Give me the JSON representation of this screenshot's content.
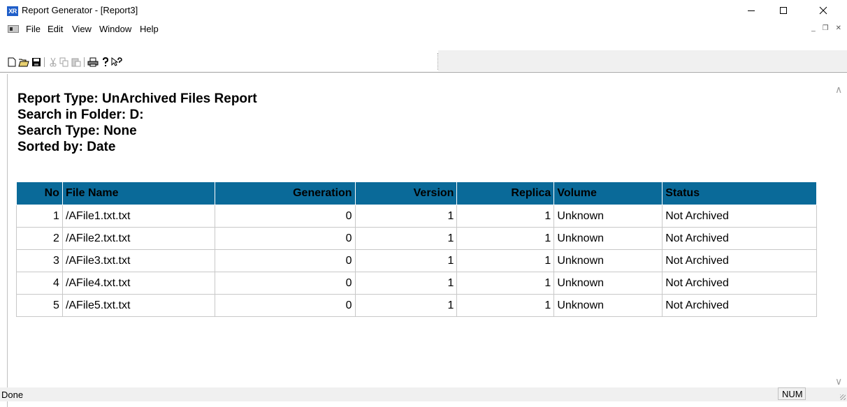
{
  "window": {
    "title": "Report Generator - [Report3]",
    "app_icon_label": "XR",
    "controls": {
      "minimize": "minimize-icon",
      "maximize": "maximize-icon",
      "close": "close-icon"
    }
  },
  "menu": {
    "items": [
      "File",
      "Edit",
      "View",
      "Window",
      "Help"
    ],
    "mdi_controls": [
      "minimize-icon",
      "restore-icon",
      "close-icon"
    ]
  },
  "toolbar": {
    "buttons": [
      "new-icon",
      "open-icon",
      "save-icon",
      "cut-icon",
      "copy-icon",
      "paste-icon",
      "print-icon",
      "about-icon",
      "context-help-icon"
    ]
  },
  "report": {
    "lines": [
      "Report Type: UnArchived Files Report",
      "Search in Folder: D:",
      "Search Type: None",
      "Sorted by: Date"
    ],
    "columns": [
      "No",
      "File Name",
      "Generation",
      "Version",
      "Replica",
      "Volume",
      "Status"
    ],
    "rows": [
      [
        "1",
        "/AFile1.txt.txt",
        "0",
        "1",
        "1",
        "Unknown",
        "Not Archived"
      ],
      [
        "2",
        "/AFile2.txt.txt",
        "0",
        "1",
        "1",
        "Unknown",
        "Not Archived"
      ],
      [
        "3",
        "/AFile3.txt.txt",
        "0",
        "1",
        "1",
        "Unknown",
        "Not Archived"
      ],
      [
        "4",
        "/AFile4.txt.txt",
        "0",
        "1",
        "1",
        "Unknown",
        "Not Archived"
      ],
      [
        "5",
        "/AFile5.txt.txt",
        "0",
        "1",
        "1",
        "Unknown",
        "Not Archived"
      ]
    ],
    "header_color": "#0a6a99"
  },
  "status": {
    "text": "Done",
    "num": "NUM"
  }
}
